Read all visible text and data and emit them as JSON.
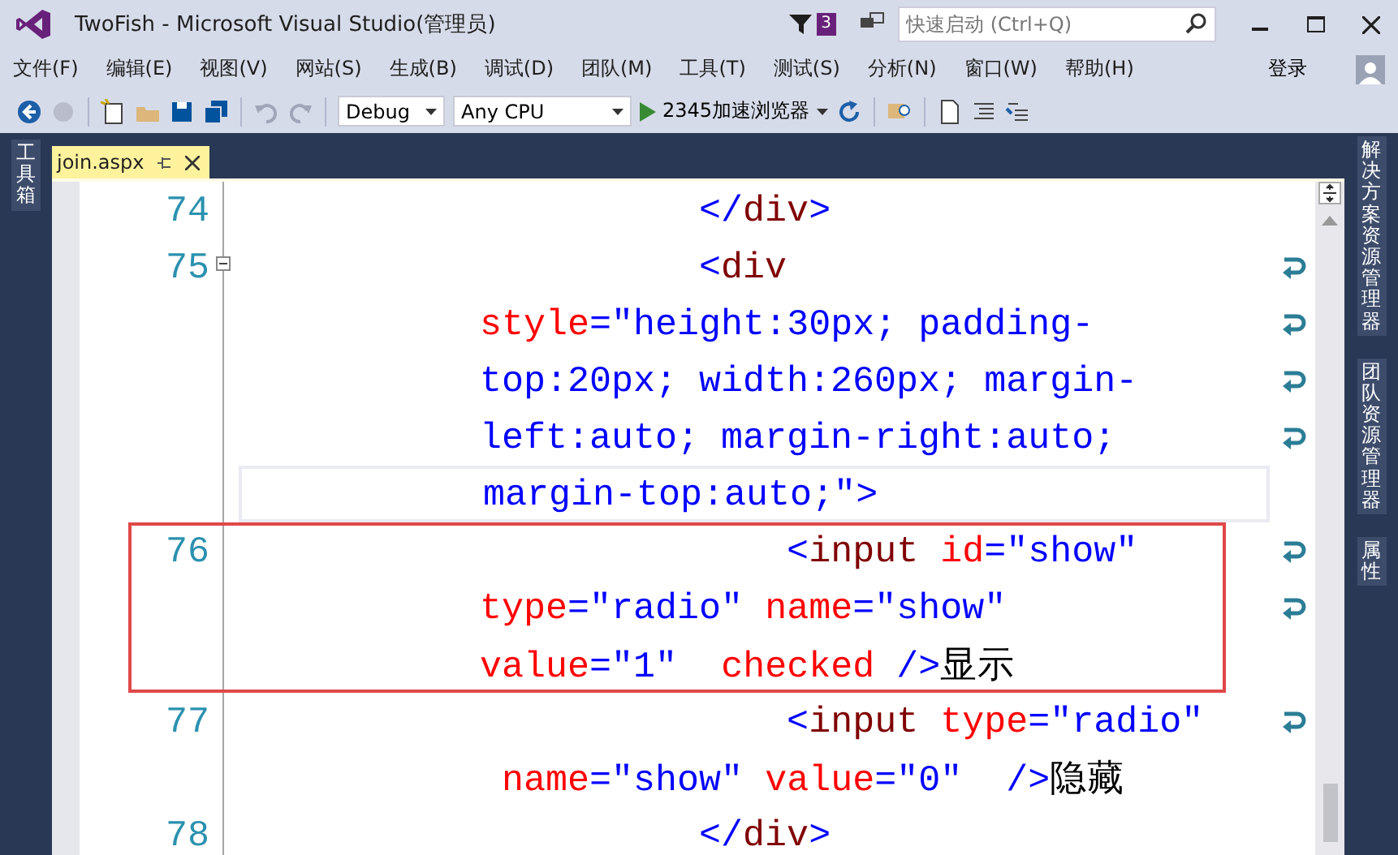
{
  "window": {
    "title": "TwoFish - Microsoft Visual Studio(管理员)",
    "notification_count": "3",
    "quick_launch": {
      "placeholder": "快速启动 (Ctrl+Q)"
    }
  },
  "menu": {
    "items": [
      "文件(F)",
      "编辑(E)",
      "视图(V)",
      "网站(S)",
      "生成(B)",
      "调试(D)",
      "团队(M)",
      "工具(T)",
      "测试(S)",
      "分析(N)",
      "窗口(W)",
      "帮助(H)"
    ],
    "sign_in": "登录"
  },
  "toolbar": {
    "configuration": "Debug",
    "platform": "Any CPU",
    "run_target": "2345加速浏览器"
  },
  "left_panel": {
    "tabs": [
      "工具箱"
    ]
  },
  "right_panel": {
    "tabs": [
      "解决方案资源管理器",
      "团队资源管理器",
      "属性"
    ]
  },
  "editor": {
    "tab": {
      "title": "join.aspx",
      "selected": true
    },
    "lines": [
      {
        "number": "74",
        "kind": "block",
        "rows": [
          {
            "tokens": [
              {
                "kind": "delim",
                "text": "</"
              },
              {
                "kind": "tag",
                "text": "div"
              },
              {
                "kind": "delim",
                "text": ">"
              }
            ]
          }
        ]
      },
      {
        "number": "75",
        "kind": "block",
        "expanded": true,
        "current": true,
        "rows": [
          {
            "tokens": [
              {
                "kind": "delim",
                "text": "<"
              },
              {
                "kind": "tag",
                "text": "div"
              }
            ]
          },
          {
            "tokens": [
              {
                "kind": "attr",
                "text": "style"
              },
              {
                "kind": "delim",
                "text": "="
              },
              {
                "kind": "value",
                "text": "\"height:30px; padding-"
              }
            ]
          },
          {
            "tokens": [
              {
                "kind": "value",
                "text": "top:20px; width:260px; margin-"
              }
            ]
          },
          {
            "tokens": [
              {
                "kind": "value",
                "text": "left:auto; margin-right:auto;"
              }
            ]
          },
          {
            "tokens": [
              {
                "kind": "value",
                "text": "margin-top:auto;\""
              },
              {
                "kind": "delim",
                "text": ">"
              }
            ]
          }
        ]
      },
      {
        "number": "76",
        "kind": "child",
        "highlighted": true,
        "rows": [
          {
            "tokens": [
              {
                "kind": "delim",
                "text": "<"
              },
              {
                "kind": "tag",
                "text": "input"
              },
              {
                "kind": "attr",
                "text": " id"
              },
              {
                "kind": "delim",
                "text": "="
              },
              {
                "kind": "value",
                "text": "\"show\""
              }
            ]
          },
          {
            "tokens": [
              {
                "kind": "attr",
                "text": "type"
              },
              {
                "kind": "delim",
                "text": "="
              },
              {
                "kind": "value",
                "text": "\"radio\""
              },
              {
                "kind": "attr",
                "text": " name"
              },
              {
                "kind": "delim",
                "text": "="
              },
              {
                "kind": "value",
                "text": "\"show\""
              }
            ]
          },
          {
            "tokens": [
              {
                "kind": "attr",
                "text": "value"
              },
              {
                "kind": "delim",
                "text": "="
              },
              {
                "kind": "value",
                "text": "\"1\""
              },
              {
                "kind": "attr",
                "text": "  checked"
              },
              {
                "kind": "delim",
                "text": " />"
              },
              {
                "kind": "text",
                "text": "显示"
              }
            ]
          }
        ]
      },
      {
        "number": "77",
        "kind": "child",
        "rows": [
          {
            "tokens": [
              {
                "kind": "delim",
                "text": "<"
              },
              {
                "kind": "tag",
                "text": "input"
              },
              {
                "kind": "attr",
                "text": " type"
              },
              {
                "kind": "delim",
                "text": "="
              },
              {
                "kind": "value",
                "text": "\"radio\""
              }
            ]
          },
          {
            "tokens": [
              {
                "kind": "attr",
                "text": " name"
              },
              {
                "kind": "delim",
                "text": "="
              },
              {
                "kind": "value",
                "text": "\"show\""
              },
              {
                "kind": "attr",
                "text": " value"
              },
              {
                "kind": "delim",
                "text": "="
              },
              {
                "kind": "value",
                "text": "\"0\""
              },
              {
                "kind": "delim",
                "text": "  />"
              },
              {
                "kind": "text",
                "text": "隐藏"
              }
            ]
          }
        ]
      },
      {
        "number": "78",
        "kind": "block",
        "rows": [
          {
            "tokens": [
              {
                "kind": "delim",
                "text": "</"
              },
              {
                "kind": "tag",
                "text": "div"
              },
              {
                "kind": "delim",
                "text": ">"
              }
            ]
          }
        ]
      }
    ]
  }
}
